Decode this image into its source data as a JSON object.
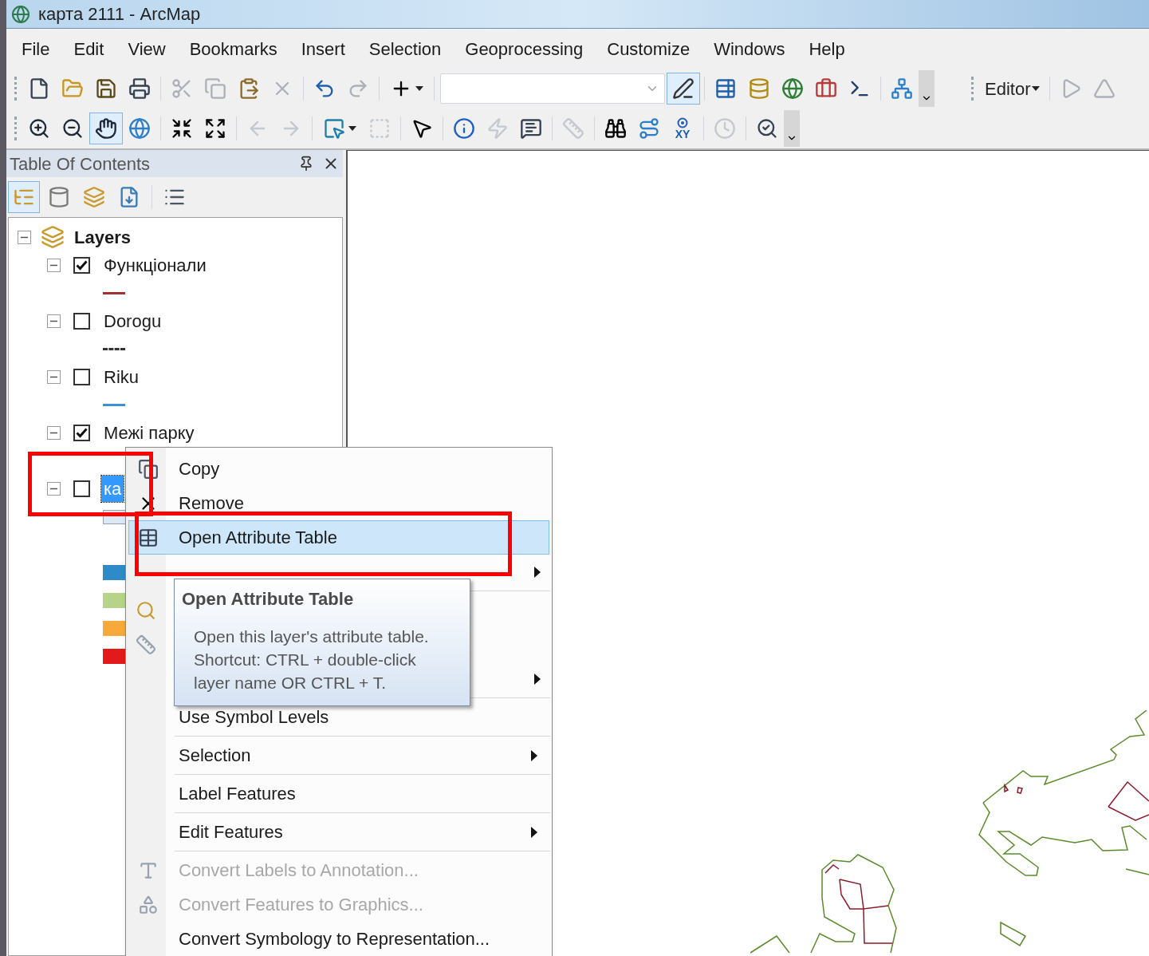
{
  "window": {
    "title": "карта 2111 - ArcMap"
  },
  "menu_bar": [
    "File",
    "Edit",
    "View",
    "Bookmarks",
    "Insert",
    "Selection",
    "Geoprocessing",
    "Customize",
    "Windows",
    "Help"
  ],
  "toolbars": [
    {
      "tools": [
        {
          "kind": "grip"
        },
        {
          "kind": "new",
          "selected": false,
          "disabled": false
        },
        {
          "kind": "open",
          "selected": false,
          "disabled": false
        },
        {
          "kind": "save",
          "selected": false,
          "disabled": false
        },
        {
          "kind": "print",
          "selected": false,
          "disabled": false
        },
        {
          "kind": "separator"
        },
        {
          "kind": "cut",
          "selected": false,
          "disabled": true
        },
        {
          "kind": "copy",
          "selected": false,
          "disabled": true
        },
        {
          "kind": "paste",
          "selected": false,
          "disabled": false
        },
        {
          "kind": "delete",
          "selected": false,
          "disabled": true
        },
        {
          "kind": "separator"
        },
        {
          "kind": "undo",
          "selected": false,
          "disabled": false
        },
        {
          "kind": "redo",
          "selected": false,
          "disabled": true
        },
        {
          "kind": "separator"
        },
        {
          "kind": "add-data",
          "selected": false,
          "disabled": false
        },
        {
          "kind": "separator"
        },
        {
          "kind": "combo"
        },
        {
          "kind": "editor-toolbar",
          "selected": true,
          "disabled": false
        },
        {
          "kind": "separator"
        },
        {
          "kind": "table-window",
          "selected": false,
          "disabled": false
        },
        {
          "kind": "catalog-window",
          "selected": false,
          "disabled": false
        },
        {
          "kind": "search-window",
          "selected": false,
          "disabled": false
        },
        {
          "kind": "toolbox-window",
          "selected": false,
          "disabled": false
        },
        {
          "kind": "python-window",
          "selected": false,
          "disabled": false
        },
        {
          "kind": "separator"
        },
        {
          "kind": "model",
          "selected": false,
          "disabled": false
        },
        {
          "kind": "overflow"
        },
        {
          "kind": "gap"
        },
        {
          "kind": "grip"
        },
        {
          "kind": "menu",
          "label": "Editor",
          "selected": false,
          "disabled": false
        },
        {
          "kind": "separator"
        },
        {
          "kind": "play",
          "selected": false,
          "disabled": true
        },
        {
          "kind": "sketch",
          "selected": false,
          "disabled": true
        }
      ]
    },
    {
      "tools": [
        {
          "kind": "grip"
        },
        {
          "kind": "zoom-in",
          "selected": false,
          "disabled": false
        },
        {
          "kind": "zoom-out",
          "selected": false,
          "disabled": false
        },
        {
          "kind": "pan",
          "selected": true,
          "disabled": false
        },
        {
          "kind": "globe",
          "selected": false,
          "disabled": false
        },
        {
          "kind": "separator"
        },
        {
          "kind": "fixed-in",
          "selected": false,
          "disabled": false
        },
        {
          "kind": "fixed-out",
          "selected": false,
          "disabled": false
        },
        {
          "kind": "separator"
        },
        {
          "kind": "back",
          "selected": false,
          "disabled": true
        },
        {
          "kind": "forward",
          "selected": false,
          "disabled": true
        },
        {
          "kind": "separator"
        },
        {
          "kind": "select-features",
          "selected": false,
          "disabled": false
        },
        {
          "kind": "clear-selection",
          "selected": false,
          "disabled": true
        },
        {
          "kind": "separator"
        },
        {
          "kind": "pointer",
          "selected": false,
          "disabled": false
        },
        {
          "kind": "separator"
        },
        {
          "kind": "identify",
          "selected": false,
          "disabled": false
        },
        {
          "kind": "hyperlink",
          "selected": false,
          "disabled": true
        },
        {
          "kind": "popup",
          "selected": false,
          "disabled": false
        },
        {
          "kind": "separator"
        },
        {
          "kind": "measure",
          "selected": false,
          "disabled": true
        },
        {
          "kind": "separator"
        },
        {
          "kind": "find",
          "selected": false,
          "disabled": false
        },
        {
          "kind": "route",
          "selected": false,
          "disabled": false
        },
        {
          "kind": "xy",
          "label": "XY",
          "selected": false,
          "disabled": false
        },
        {
          "kind": "separator"
        },
        {
          "kind": "time",
          "selected": false,
          "disabled": true
        },
        {
          "kind": "separator"
        },
        {
          "kind": "magnifier",
          "selected": false,
          "disabled": false
        },
        {
          "kind": "overflow"
        }
      ]
    }
  ],
  "table_of_contents": {
    "title": "Table Of Contents",
    "tools": [
      {
        "kind": "drawing-order",
        "selected": true
      },
      {
        "kind": "source",
        "selected": false
      },
      {
        "kind": "visibility",
        "selected": false
      },
      {
        "kind": "selection",
        "selected": false
      },
      {
        "kind": "separator"
      },
      {
        "kind": "options",
        "selected": false
      }
    ],
    "root": {
      "label": "Layers",
      "expanded": true
    },
    "layers": [
      {
        "name": "Функціонали",
        "checked": true,
        "expanded": true,
        "selected": false,
        "symbol": {
          "kind": "line",
          "color": "#a0302e"
        }
      },
      {
        "name": "Dorogu",
        "checked": false,
        "expanded": true,
        "selected": false,
        "symbol": {
          "kind": "dashed",
          "color": "#333333"
        }
      },
      {
        "name": "Riku",
        "checked": false,
        "expanded": true,
        "selected": false,
        "symbol": {
          "kind": "line",
          "color": "#3d8fd8"
        }
      },
      {
        "name": "Межі парку",
        "checked": true,
        "expanded": true,
        "selected": false
      },
      {
        "name": "ка",
        "checked": false,
        "expanded": true,
        "selected": true,
        "symbol": {
          "kind": "fill",
          "color": "#dce8f5"
        },
        "classes": [
          {
            "color": "#2e8bc8"
          },
          {
            "color": "#b5d48a"
          },
          {
            "color": "#f7a93a"
          },
          {
            "color": "#e31a1c"
          }
        ]
      }
    ]
  },
  "context_menu": {
    "items": [
      {
        "kind": "item",
        "label": "Copy",
        "selected": false,
        "disabled": false,
        "submenu": false
      },
      {
        "kind": "item",
        "label": "Remove",
        "selected": false,
        "disabled": false,
        "submenu": false
      },
      {
        "kind": "item",
        "label": "Open Attribute Table",
        "selected": true,
        "disabled": false,
        "submenu": false
      },
      {
        "kind": "covered",
        "submenu": true
      },
      {
        "kind": "separator"
      },
      {
        "kind": "covered",
        "submenu": false
      },
      {
        "kind": "covered",
        "submenu": false
      },
      {
        "kind": "covered",
        "submenu": true
      },
      {
        "kind": "separator"
      },
      {
        "kind": "item",
        "label": "Use Symbol Levels",
        "selected": false,
        "disabled": false,
        "submenu": false
      },
      {
        "kind": "separator"
      },
      {
        "kind": "item",
        "label": "Selection",
        "selected": false,
        "disabled": false,
        "submenu": true
      },
      {
        "kind": "separator"
      },
      {
        "kind": "item",
        "label": "Label Features",
        "selected": false,
        "disabled": false,
        "submenu": false
      },
      {
        "kind": "separator"
      },
      {
        "kind": "item",
        "label": "Edit Features",
        "selected": false,
        "disabled": false,
        "submenu": true
      },
      {
        "kind": "separator"
      },
      {
        "kind": "item",
        "label": "Convert Labels to Annotation...",
        "selected": false,
        "disabled": true,
        "submenu": false
      },
      {
        "kind": "item",
        "label": "Convert Features to Graphics...",
        "selected": false,
        "disabled": true,
        "submenu": false
      },
      {
        "kind": "item",
        "label": "Convert Symbology to Representation...",
        "selected": false,
        "disabled": false,
        "submenu": false
      }
    ]
  },
  "tooltip": {
    "title": "Open Attribute Table",
    "body_lines": [
      "Open this layer's attribute table.",
      "Shortcut: CTRL + double-click",
      "layer name OR CTRL + T."
    ]
  }
}
